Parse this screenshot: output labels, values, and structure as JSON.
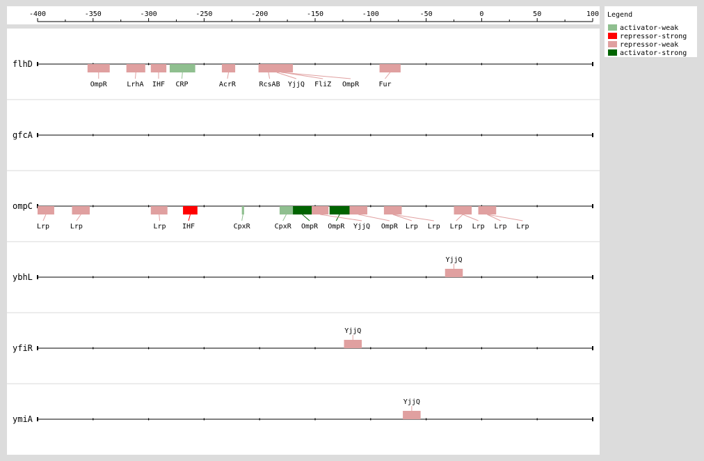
{
  "axis": {
    "min": -400,
    "max": 100,
    "tick_labels": [
      "-400",
      "-350",
      "-300",
      "-250",
      "-200",
      "-150",
      "-100",
      "-50",
      "0",
      "50",
      "100"
    ]
  },
  "legend": {
    "title": "Legend",
    "items": [
      {
        "key": "activator-weak",
        "label": "activator-weak",
        "color": "#8fbf8f"
      },
      {
        "key": "repressor-strong",
        "label": "repressor-strong",
        "color": "#ff0000"
      },
      {
        "key": "repressor-weak",
        "label": "repressor-weak",
        "color": "#e0a0a0"
      },
      {
        "key": "activator-strong",
        "label": "activator-strong",
        "color": "#006400"
      }
    ]
  },
  "chart_data": {
    "type": "promoter-map",
    "x_range": [
      -400,
      100
    ],
    "tracks": [
      {
        "gene": "flhD",
        "sites": [
          {
            "name": "OmpR",
            "start": -355,
            "end": -335,
            "type": "repressor-weak",
            "label_x": -345
          },
          {
            "name": "LrhA",
            "start": -320,
            "end": -303,
            "type": "repressor-weak",
            "label_x": -312
          },
          {
            "name": "IHF",
            "start": -298,
            "end": -284,
            "type": "repressor-weak",
            "label_x": -291
          },
          {
            "name": "CRP",
            "start": -281,
            "end": -258,
            "type": "activator-weak",
            "label_x": -270
          },
          {
            "name": "AcrR",
            "start": -234,
            "end": -222,
            "type": "repressor-weak",
            "label_x": -229
          },
          {
            "name": "RcsAB",
            "start": -201,
            "end": -183,
            "type": "repressor-weak",
            "label_x": -191
          },
          {
            "name": "YjjQ",
            "start": -192,
            "end": -177,
            "type": "repressor-weak",
            "label_x": -167
          },
          {
            "name": "FliZ",
            "start": -189,
            "end": -170,
            "type": "repressor-weak",
            "label_x": -143
          },
          {
            "name": "OmpR",
            "start": -186,
            "end": -175,
            "type": "repressor-weak",
            "label_x": -118
          },
          {
            "name": "Fur",
            "start": -92,
            "end": -73,
            "type": "repressor-weak",
            "label_x": -87
          }
        ]
      },
      {
        "gene": "gfcA",
        "sites": []
      },
      {
        "gene": "ompC",
        "sites": [
          {
            "name": "Lrp",
            "start": -400,
            "end": -385,
            "type": "repressor-weak",
            "label_x": -395
          },
          {
            "name": "Lrp",
            "start": -369,
            "end": -353,
            "type": "repressor-weak",
            "label_x": -365
          },
          {
            "name": "Lrp",
            "start": -298,
            "end": -283,
            "type": "repressor-weak",
            "label_x": -290
          },
          {
            "name": "IHF",
            "start": -269,
            "end": -256,
            "type": "repressor-strong",
            "label_x": -264
          },
          {
            "name": "CpxR",
            "start": -216,
            "end": -214,
            "type": "activator-weak",
            "label_x": -216
          },
          {
            "name": "CpxR",
            "start": -182,
            "end": -170,
            "type": "activator-weak",
            "label_x": -179
          },
          {
            "name": "OmpR",
            "start": -170,
            "end": -153,
            "type": "activator-strong",
            "label_x": -155
          },
          {
            "name": "OmpR",
            "start": -137,
            "end": -119,
            "type": "activator-strong",
            "label_x": -131
          },
          {
            "name": "YjjQ",
            "start": -153,
            "end": -138,
            "type": "repressor-weak",
            "label_x": -108
          },
          {
            "name": "OmpR",
            "start": -119,
            "end": -103,
            "type": "repressor-weak",
            "label_x": -83
          },
          {
            "name": "Lrp",
            "start": -88,
            "end": -72,
            "type": "repressor-weak",
            "label_x": -63
          },
          {
            "name": "Lrp",
            "start": -88,
            "end": -72,
            "type": "repressor-weak",
            "label_x": -43
          },
          {
            "name": "Lrp",
            "start": -25,
            "end": -9,
            "type": "repressor-weak",
            "label_x": -23
          },
          {
            "name": "Lrp",
            "start": -25,
            "end": -9,
            "type": "repressor-weak",
            "label_x": -3
          },
          {
            "name": "Lrp",
            "start": -3,
            "end": 13,
            "type": "repressor-weak",
            "label_x": 17
          },
          {
            "name": "Lrp",
            "start": -3,
            "end": 13,
            "type": "repressor-weak",
            "label_x": 37
          }
        ]
      },
      {
        "gene": "ybhL",
        "sites": [
          {
            "name": "YjjQ",
            "start": -33,
            "end": -17,
            "type": "repressor-weak",
            "label_x": -25,
            "above": true
          }
        ]
      },
      {
        "gene": "yfiR",
        "sites": [
          {
            "name": "YjjQ",
            "start": -124,
            "end": -108,
            "type": "repressor-weak",
            "label_x": -116,
            "above": true
          }
        ]
      },
      {
        "gene": "ymiA",
        "sites": [
          {
            "name": "YjjQ",
            "start": -71,
            "end": -55,
            "type": "repressor-weak",
            "label_x": -63,
            "above": true
          }
        ]
      }
    ]
  }
}
